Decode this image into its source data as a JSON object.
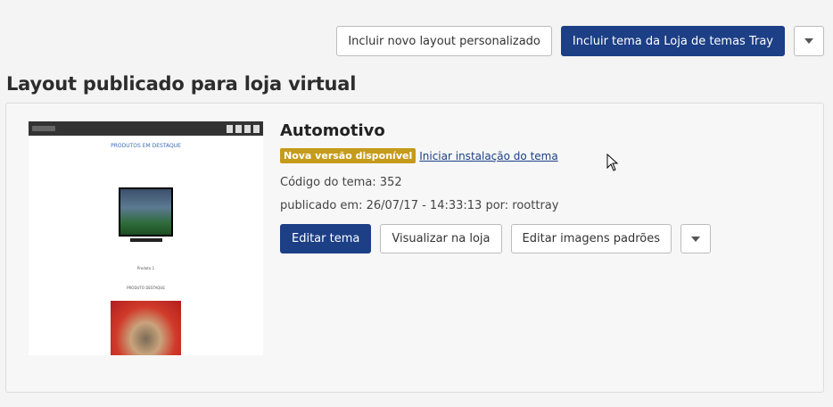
{
  "toolbar": {
    "add_custom_layout": "Incluir novo layout personalizado",
    "add_tray_theme": "Incluir tema da Loja de temas Tray"
  },
  "page_title": "Layout publicado para loja virtual",
  "theme": {
    "name": "Automotivo",
    "badge": "Nova versão disponível",
    "install_link": "Iniciar instalação do tema",
    "code": "Código do tema: 352",
    "published": "publicado em: 26/07/17 - 14:33:13 por: roottray"
  },
  "actions": {
    "edit": "Editar tema",
    "view": "Visualizar na loja",
    "edit_images": "Editar imagens padrões"
  },
  "thumbnail": {
    "heading": "PRODUTOS EM DESTAQUE",
    "product_text": "Produto 1",
    "section_text": "PRODUTO DESTAQUE"
  },
  "colors": {
    "primary": "#1c3f85",
    "badge": "#c59b1c"
  }
}
